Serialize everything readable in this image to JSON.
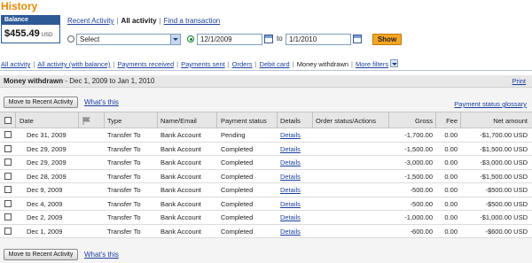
{
  "page_title": "History",
  "balance": {
    "label": "Balance",
    "amount": "$455.49",
    "currency": "USD"
  },
  "topnav": {
    "recent": "Recent Activity",
    "all": "All activity",
    "find": "Find a transaction"
  },
  "filters": {
    "select_value": "Select",
    "from_date": "12/1/2009",
    "to_label": "to",
    "to_date": "1/1/2010",
    "show_label": "Show"
  },
  "tabs": [
    "All activity",
    "All activity (with balance)",
    "Payments received",
    "Payments sent",
    "Orders",
    "Debit card",
    "Money withdrawn",
    "More filters"
  ],
  "panel": {
    "title_bold": "Money withdrawn",
    "title_range": " - Dec 1, 2009 to Jan 1, 2010",
    "print": "Print",
    "move_btn": "Move to Recent Activity",
    "whats_this": "What's this",
    "glossary": "Payment status glossary"
  },
  "table": {
    "headers": {
      "date": "Date",
      "type": "Type",
      "name": "Name/Email",
      "status": "Payment status",
      "details": "Details",
      "order": "Order status/Actions",
      "gross": "Gross",
      "fee": "Fee",
      "net": "Net amount"
    },
    "rows": [
      {
        "date": "Dec 31, 2009",
        "type": "Transfer To",
        "name": "Bank Account",
        "status": "Pending",
        "details": "Details",
        "gross": "-1,700.00",
        "fee": "0.00",
        "net": "-$1,700.00 USD"
      },
      {
        "date": "Dec 29, 2009",
        "type": "Transfer To",
        "name": "Bank Account",
        "status": "Completed",
        "details": "Details",
        "gross": "-1,500.00",
        "fee": "0.00",
        "net": "-$1,500.00 USD"
      },
      {
        "date": "Dec 29, 2009",
        "type": "Transfer To",
        "name": "Bank Account",
        "status": "Completed",
        "details": "Details",
        "gross": "-3,000.00",
        "fee": "0.00",
        "net": "-$3,000.00 USD"
      },
      {
        "date": "Dec 28, 2009",
        "type": "Transfer To",
        "name": "Bank Account",
        "status": "Completed",
        "details": "Details",
        "gross": "-1,500.00",
        "fee": "0.00",
        "net": "-$1,500.00 USD"
      },
      {
        "date": "Dec 9, 2009",
        "type": "Transfer To",
        "name": "Bank Account",
        "status": "Completed",
        "details": "Details",
        "gross": "-500.00",
        "fee": "0.00",
        "net": "-$500.00 USD"
      },
      {
        "date": "Dec 4, 2009",
        "type": "Transfer To",
        "name": "Bank Account",
        "status": "Completed",
        "details": "Details",
        "gross": "-500.00",
        "fee": "0.00",
        "net": "-$500.00 USD"
      },
      {
        "date": "Dec 2, 2009",
        "type": "Transfer To",
        "name": "Bank Account",
        "status": "Completed",
        "details": "Details",
        "gross": "-1,000.00",
        "fee": "0.00",
        "net": "-$1,000.00 USD"
      },
      {
        "date": "Dec 1, 2009",
        "type": "Transfer To",
        "name": "Bank Account",
        "status": "Completed",
        "details": "Details",
        "gross": "-600.00",
        "fee": "0.00",
        "net": "-$600.00 USD"
      }
    ]
  },
  "colors": {
    "title": "#e18b00",
    "link": "#1a3f9c",
    "show_button": "#f7a623",
    "balance_header": "#2d5a96"
  }
}
